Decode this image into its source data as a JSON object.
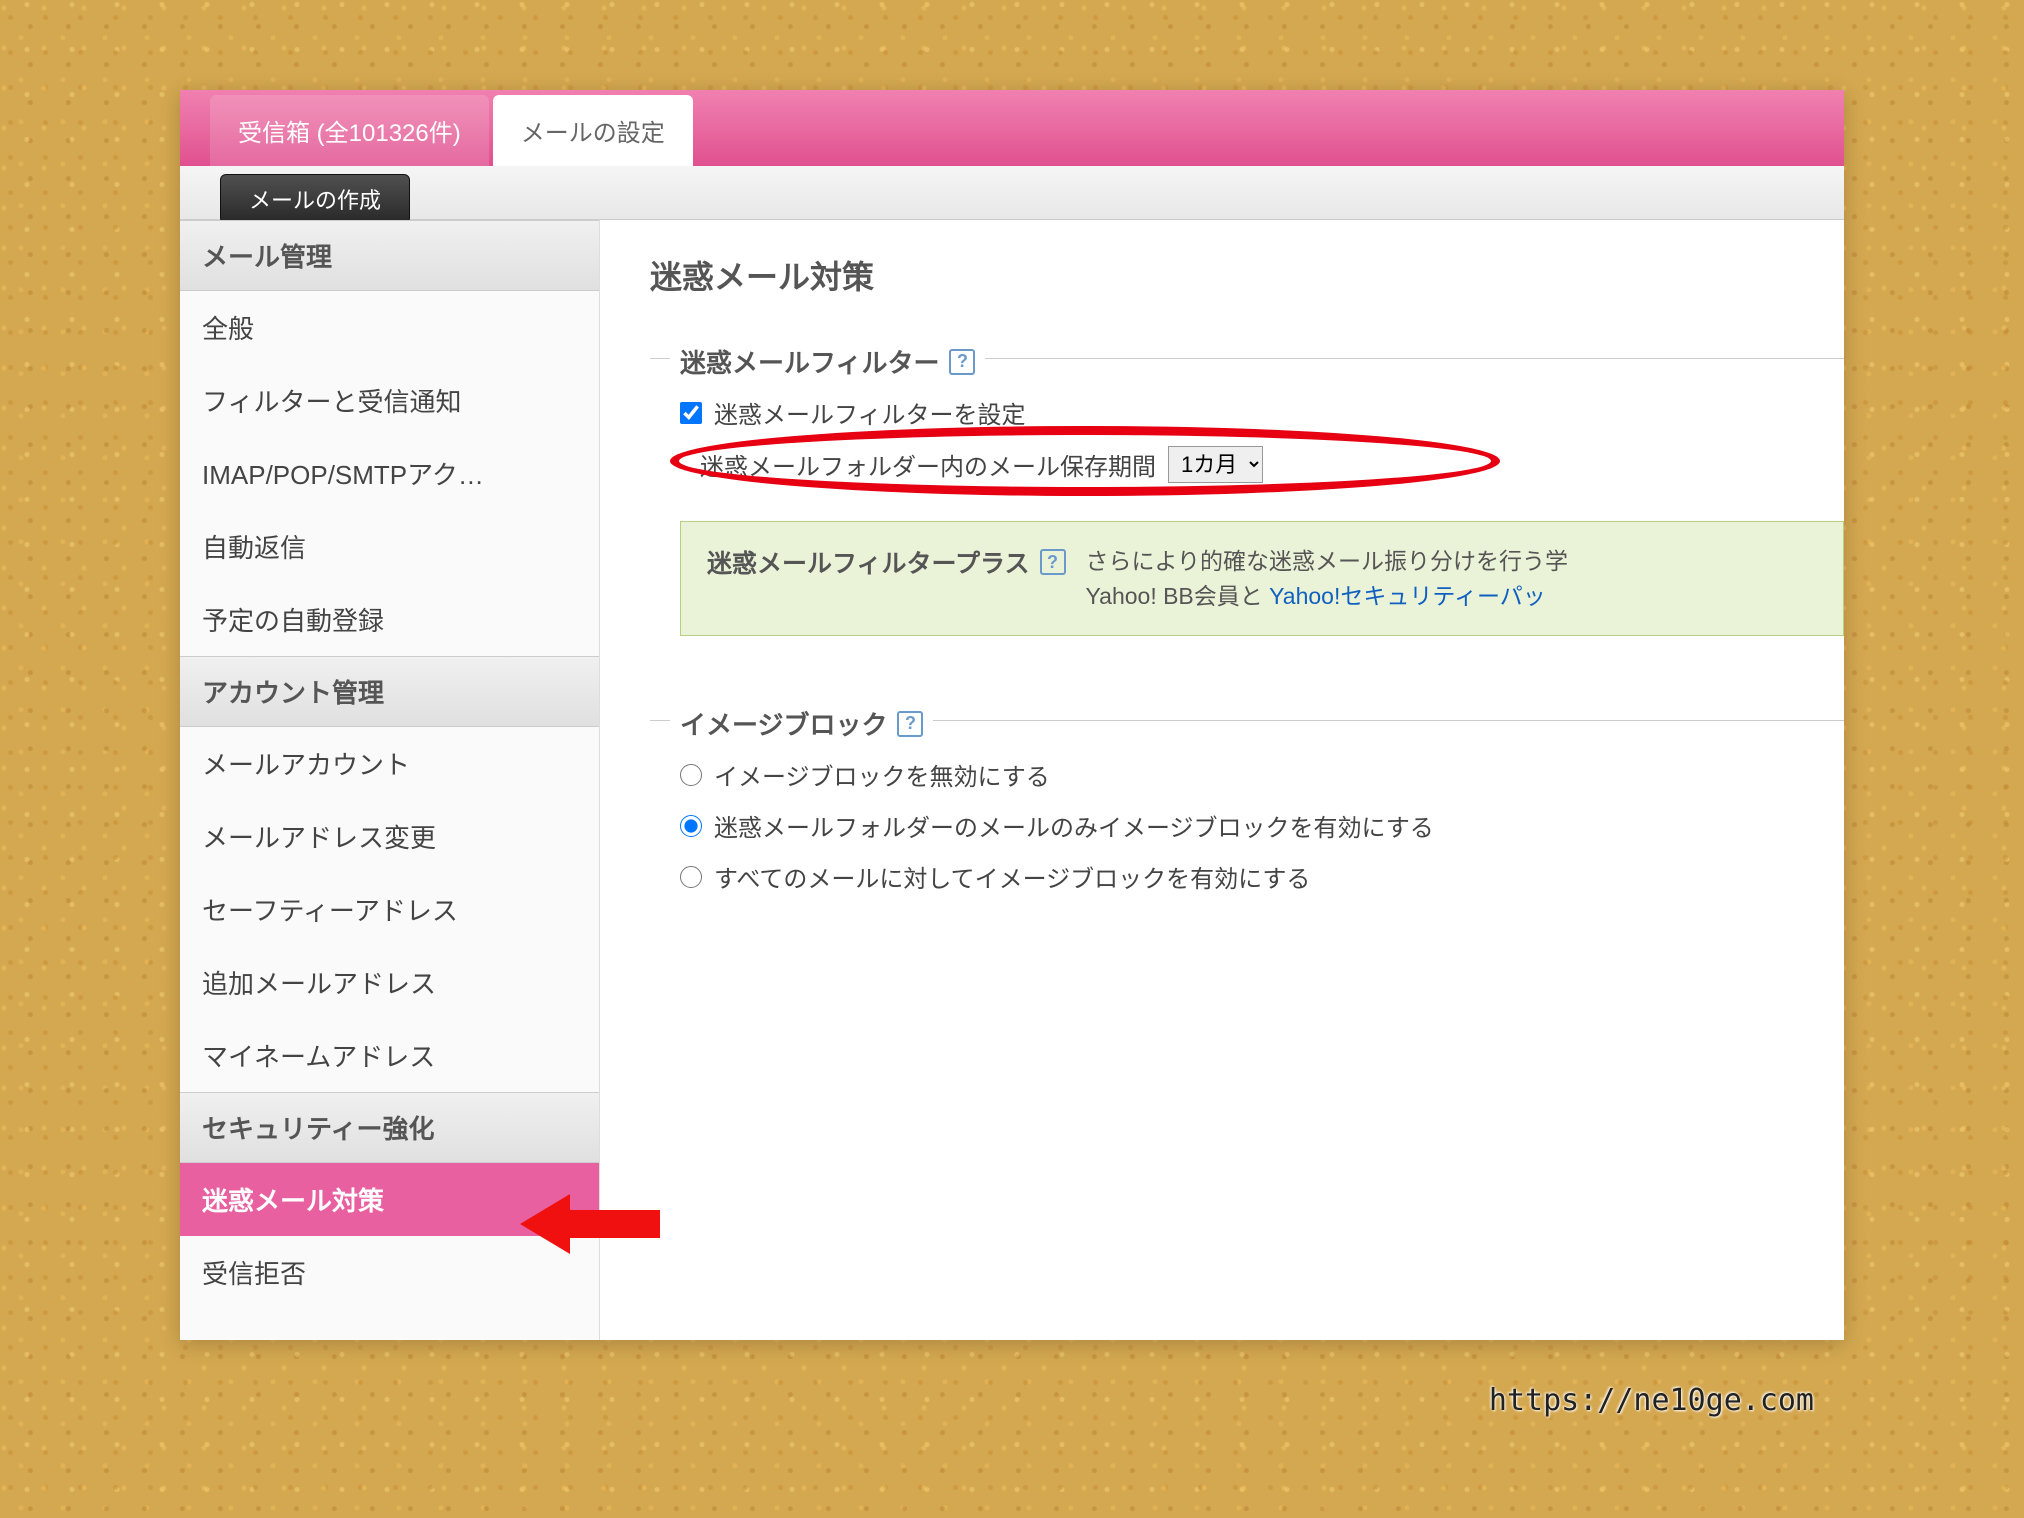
{
  "tabs": {
    "inbox_label": "受信箱",
    "inbox_count": "(全101326件)",
    "settings_label": "メールの設定"
  },
  "toolbar": {
    "compose_label": "メールの作成"
  },
  "sidebar": {
    "sections": [
      {
        "header": "メール管理",
        "items": [
          "全般",
          "フィルターと受信通知",
          "IMAP/POP/SMTPアク…",
          "自動返信",
          "予定の自動登録"
        ]
      },
      {
        "header": "アカウント管理",
        "items": [
          "メールアカウント",
          "メールアドレス変更",
          "セーフティーアドレス",
          "追加メールアドレス",
          "マイネームアドレス"
        ]
      },
      {
        "header": "セキュリティー強化",
        "items": [
          "迷惑メール対策",
          "受信拒否"
        ]
      }
    ],
    "active_item": "迷惑メール対策"
  },
  "main": {
    "title": "迷惑メール対策",
    "spam_filter": {
      "legend": "迷惑メールフィルター",
      "checkbox_label": "迷惑メールフィルターを設定",
      "checkbox_checked": true,
      "retention_label": "迷惑メールフォルダー内のメール保存期間",
      "retention_value": "1カ月"
    },
    "promo": {
      "title": "迷惑メールフィルタープラス",
      "text_1": "さらにより的確な迷惑メール振り分けを行う学",
      "text_2a": "Yahoo! BB会員と ",
      "text_2b": "Yahoo!セキュリティーパッ"
    },
    "image_block": {
      "legend": "イメージブロック",
      "options": [
        "イメージブロックを無効にする",
        "迷惑メールフォルダーのメールのみイメージブロックを有効にする",
        "すべてのメールに対してイメージブロックを有効にする"
      ],
      "selected_index": 1
    }
  },
  "watermark": "https://ne10ge.com"
}
